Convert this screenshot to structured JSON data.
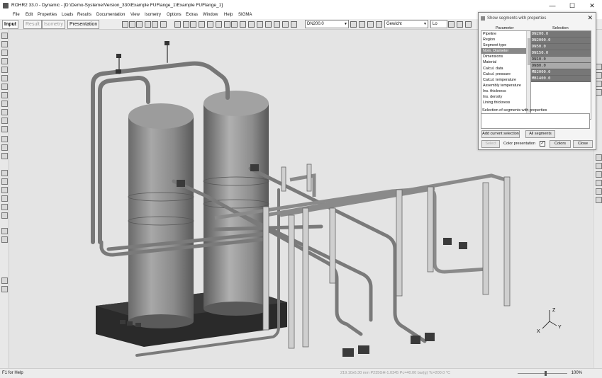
{
  "window": {
    "title": "ROHR2 33.0 - Dynamic - [D:\\Demo-Systeme\\Version_330\\Example FUFlange_1\\Example FUFlange_1]",
    "min_icon": "—",
    "max_icon": "☐",
    "close_icon": "✕"
  },
  "menu": {
    "items": [
      "File",
      "Edit",
      "Properties",
      "Loads",
      "Results",
      "Documentation",
      "View",
      "Isometry",
      "Options",
      "Extras",
      "Window",
      "Help",
      "SIGMA"
    ]
  },
  "toolbar": {
    "tabs": [
      "Input",
      "Result",
      "Isometry",
      "Presentation"
    ],
    "combo_segment": "DN200.0",
    "combo_property": "Gewicht",
    "combo_small": "Lo"
  },
  "dialog": {
    "title": "Show segments with properties",
    "close_icon": "✕",
    "parameter_header": "Parameter",
    "selection_header": "Selection",
    "parameters": [
      "Pipeline",
      "Region",
      "Segment type",
      "Nom. Diameter",
      "Dimensions",
      "Material",
      "Calcul. data",
      "Calcul. pressure",
      "Calcul. temperature",
      "Assembly temperature",
      "Ins. thickness",
      "Ins. density",
      "Lining thickness"
    ],
    "selected_parameter_index": 3,
    "selections": [
      "DN200.0",
      "DN2000.0",
      "DN50.0",
      "DN150.0",
      "DN10.0",
      "DN80.0",
      "MB2000.0",
      "MB1400.0"
    ],
    "highlighted_selections": [
      4,
      5
    ],
    "segments_label": "Selection of segments with properties",
    "add_button": "Add current selection",
    "all_button": "All segments",
    "select_button": "Select",
    "color_label": "Color presentation",
    "color_checked": "✓",
    "colors_button": "Colors",
    "close_button": "Close"
  },
  "status": {
    "help": "F1 for Help",
    "info": "219.10x6.30 mm P235GH-1.0345 Pc=40.00 bar(g) Tc=200.0 °C",
    "zoom": "100%"
  },
  "axes": {
    "x": "X",
    "y": "Y",
    "z": "Z"
  }
}
